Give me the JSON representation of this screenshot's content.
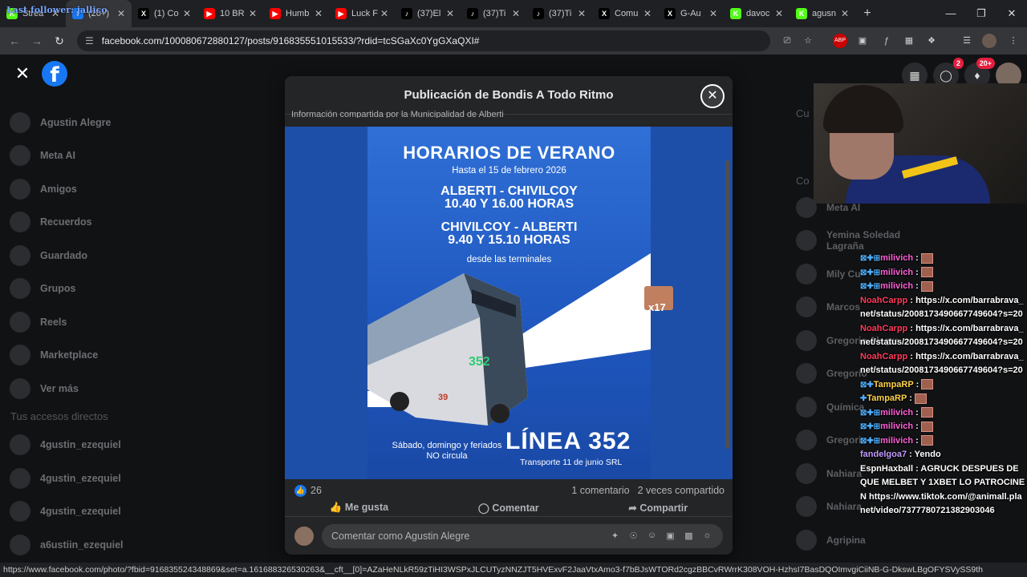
{
  "browser": {
    "overlay_text": "Last follower: jallico",
    "tabs": [
      {
        "label": "Strea",
        "icon": "kick",
        "color": "#53fc18"
      },
      {
        "label": "(20+)",
        "icon": "facebook",
        "color": "#1877f2",
        "active": true
      },
      {
        "label": "(1) Co",
        "icon": "x",
        "color": "#000000"
      },
      {
        "label": "10 BR",
        "icon": "youtube",
        "color": "#ff0000"
      },
      {
        "label": "Humb",
        "icon": "youtube",
        "color": "#ff0000"
      },
      {
        "label": "Luck F",
        "icon": "youtube",
        "color": "#ff0000"
      },
      {
        "label": "(37)El",
        "icon": "tiktok",
        "color": "#000000"
      },
      {
        "label": "(37)Ti",
        "icon": "tiktok",
        "color": "#000000"
      },
      {
        "label": "(37)Ti",
        "icon": "tiktok",
        "color": "#000000"
      },
      {
        "label": "Comu",
        "icon": "x",
        "color": "#000000"
      },
      {
        "label": "G-Au",
        "icon": "x",
        "color": "#000000"
      },
      {
        "label": "davoc",
        "icon": "kick",
        "color": "#53fc18"
      },
      {
        "label": "agusn",
        "icon": "kick",
        "color": "#53fc18"
      }
    ],
    "url": "facebook.com/100080672880127/posts/916835551015533/?rdid=tcSGaXc0YgGXaQXI#",
    "status_url": "https://www.facebook.com/photo/?fbid=916835524348869&set=a.161688326530263&__cft__[0]=AZaHeNLkR59zTiHI3WSPxJLCUTyzNNZJT5HVExvF2JaaVtxAmo3-f7bBJsWTORd2cgzBBCvRWrrK308VOH-HzhsI7BasDQOImvgiCiiNB-G-DkswLBgOFYSVySS9th"
  },
  "facebook": {
    "logo": "f",
    "messenger_badge": "2",
    "notifications_badge": "20+",
    "sidebar": [
      "Agustin Alegre",
      "Meta AI",
      "Amigos",
      "Recuerdos",
      "Guardado",
      "Grupos",
      "Reels",
      "Marketplace",
      "Ver más"
    ],
    "shortcuts_heading": "Tus accesos directos",
    "shortcuts": [
      "4gustin_ezequiel",
      "4gustin_ezequiel",
      "4gustin_ezequiel",
      "a6ustiin_ezequiel"
    ],
    "contacts_heading_1": "Cu",
    "contacts_heading_2": "Co",
    "contacts": [
      "Meta AI",
      "Yemina Soledad Lagraña",
      "Mily Cu",
      "Marcos",
      "Gregorio Alegre",
      "Gregorio",
      "Química",
      "Gregorio",
      "Nahiara",
      "Nahiara",
      "Agripina"
    ]
  },
  "modal": {
    "title": "Publicación de Bondis A Todo Ritmo",
    "cut_text": "Información compartida por la Municipalidad de Alberti",
    "poster": {
      "heading": "HORARIOS DE VERANO",
      "subheading": "Hasta el 15 de febrero 2026",
      "route1": "ALBERTI - CHIVILCOY",
      "times1": "10.40 Y 16.00 HORAS",
      "route2": "CHIVILCOY - ALBERTI",
      "times2": "9.40 Y 15.10 HORAS",
      "from": "desde las terminales",
      "days": "Sábado, domingo y feriados",
      "no_service": "NO circula",
      "line": "LÍNEA 352",
      "company": "Transporte 11 de junio SRL",
      "bus_number": "352",
      "bus_side": "39"
    },
    "sticker_text": "x17",
    "reaction_count": "26",
    "comments": "1 comentario",
    "shares": "2 veces compartido",
    "actions": [
      "Me gusta",
      "Comentar",
      "Compartir"
    ],
    "comment_placeholder": "Comentar como Agustin Alegre"
  },
  "chat": [
    {
      "user": "milivich",
      "msg": ":",
      "color": "#ff5fd7",
      "badges": "⊠✚⊞",
      "emote": true
    },
    {
      "user": "milivich",
      "msg": ":",
      "color": "#ff5fd7",
      "badges": "⊠✚⊞",
      "emote": true
    },
    {
      "user": "milivich",
      "msg": ":",
      "color": "#ff5fd7",
      "badges": "⊠✚⊞",
      "emote": true
    },
    {
      "user": "NoahCarpp",
      "msg": ": https://x.com/barrabrava_net/status/2008173490667749604?s=20",
      "color": "#ff3b5c",
      "badges": "",
      "emote": false
    },
    {
      "user": "NoahCarpp",
      "msg": ": https://x.com/barrabrava_net/status/2008173490667749604?s=20",
      "color": "#ff3b5c",
      "badges": "",
      "emote": false
    },
    {
      "user": "NoahCarpp",
      "msg": ": https://x.com/barrabrava_net/status/2008173490667749604?s=20",
      "color": "#ff3b5c",
      "badges": "",
      "emote": false
    },
    {
      "user": "TampaRP",
      "msg": ":",
      "color": "#ffd24a",
      "badges": "⊠✚",
      "emote": true
    },
    {
      "user": "TampaRP",
      "msg": ":",
      "color": "#ffd24a",
      "badges": "✚",
      "emote": true
    },
    {
      "user": "milivich",
      "msg": ":",
      "color": "#ff5fd7",
      "badges": "⊠✚⊞",
      "emote": true
    },
    {
      "user": "milivich",
      "msg": ":",
      "color": "#ff5fd7",
      "badges": "⊠✚⊞",
      "emote": true
    },
    {
      "user": "milivich",
      "msg": ":",
      "color": "#ff5fd7",
      "badges": "⊠✚⊞",
      "emote": true
    },
    {
      "user": "fandelgoa7",
      "msg": ": Yendo",
      "color": "#c49bff",
      "badges": "",
      "emote": false
    },
    {
      "user": "EspnHaxball",
      "msg": ": AGRUCK DESPUES DE QUE MELBET Y 1XBET LO PATROCINEN https://www.tiktok.com/@animall.planet/video/7377780721382903046",
      "color": "#ffffff",
      "badges": "",
      "emote": false
    }
  ]
}
